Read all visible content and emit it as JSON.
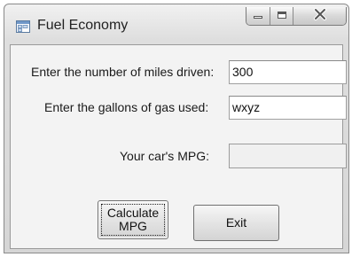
{
  "window": {
    "title": "Fuel Economy",
    "controls": [
      "minimize",
      "maximize",
      "close"
    ]
  },
  "form": {
    "miles_label": "Enter the number of miles driven:",
    "miles_value": "300",
    "gallons_label": "Enter the gallons of gas used:",
    "gallons_value": "wxyz",
    "mpg_label": "Your car's MPG:",
    "mpg_value": ""
  },
  "buttons": {
    "calculate_label": "Calculate MPG",
    "exit_label": "Exit"
  },
  "icons": {
    "app": "form-icon",
    "minimize": "minimize-icon",
    "maximize": "maximize-icon",
    "close": "close-icon"
  }
}
